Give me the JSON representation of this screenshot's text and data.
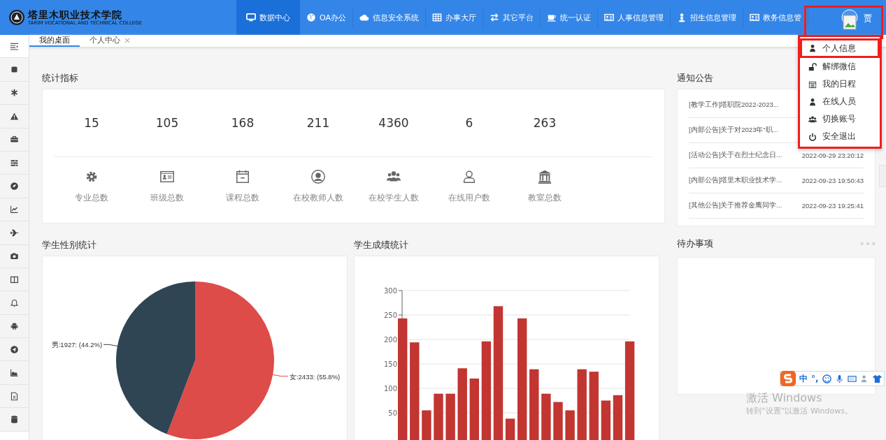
{
  "header": {
    "logo_title": "塔里木职业技术学院",
    "logo_subtitle": "TARIM VOCATIONAL AND TECHNICAL COLLEGE",
    "nav": [
      {
        "label": "数据中心",
        "selected": true
      },
      {
        "label": "OA办公",
        "selected": false
      },
      {
        "label": "信息安全系统",
        "selected": false
      },
      {
        "label": "办事大厅",
        "selected": false
      },
      {
        "label": "其它平台",
        "selected": false
      },
      {
        "label": "统一认证",
        "selected": false
      },
      {
        "label": "人事信息管理",
        "selected": false
      },
      {
        "label": "招生信息管理",
        "selected": false
      },
      {
        "label": "教务信息管",
        "selected": false
      }
    ],
    "user": "贾"
  },
  "tabs": [
    {
      "label": "我的桌面",
      "selected": true,
      "closable": false
    },
    {
      "label": "个人中心",
      "selected": false,
      "closable": true
    }
  ],
  "stats": {
    "title": "统计指标",
    "items": [
      {
        "value": "15",
        "label": "专业总数"
      },
      {
        "value": "105",
        "label": "班级总数"
      },
      {
        "value": "168",
        "label": "课程总数"
      },
      {
        "value": "211",
        "label": "在校教师人数"
      },
      {
        "value": "4360",
        "label": "在校学生人数"
      },
      {
        "value": "6",
        "label": "在线用户数"
      },
      {
        "value": "263",
        "label": "教室总数"
      }
    ]
  },
  "gender_chart": {
    "title": "学生性别统计",
    "chart_data": {
      "type": "pie",
      "categories": [
        "女",
        "男"
      ],
      "values": [
        2433,
        1927
      ],
      "colors": [
        "#dd4c48",
        "#2f4554"
      ],
      "value_labels": [
        ":2433: (55.8%)",
        ":1927: (44.2%)"
      ]
    }
  },
  "score_chart": {
    "title": "学生成绩统计",
    "chart_data": {
      "type": "bar",
      "ylim": [
        0,
        300
      ],
      "yticks": [
        50,
        100,
        150,
        200,
        250,
        300
      ],
      "grid": true,
      "series": [
        {
          "color": "#c23531",
          "values": [
            243,
            194,
            55,
            89,
            89,
            141,
            120,
            196,
            268,
            38,
            243,
            139,
            89,
            72,
            55,
            139,
            134,
            75,
            86,
            196
          ]
        }
      ]
    }
  },
  "notices": {
    "title": "通知公告",
    "items": [
      {
        "title": "[教学工作]塔职院2022-2023..."
      },
      {
        "title": "[内部公告]关于对2023年“职..."
      },
      {
        "title": "[活动公告]关于在烈士纪念日...",
        "time": "2022-09-29 23:20:12"
      },
      {
        "title": "[内部公告]塔里木职业技术学...",
        "time": "2022-09-23 19:50:43"
      },
      {
        "title": "[其他公告]关于推荐金鹰同学...",
        "time": "2022-09-23 19:25:41"
      }
    ]
  },
  "todo": {
    "title": "待办事项"
  },
  "user_menu": {
    "items": [
      {
        "label": "个人信息",
        "selected": true
      },
      {
        "label": "解绑微信",
        "selected": false
      },
      {
        "label": "我的日程",
        "selected": false
      },
      {
        "label": "在线人员",
        "selected": false
      },
      {
        "label": "切换账号",
        "selected": false
      },
      {
        "label": "安全退出",
        "selected": false
      }
    ]
  },
  "ime_bar": {
    "lang": "中",
    "punct": "°,"
  },
  "os_notice": {
    "title": "激活 Windows",
    "text": "转到“设置”以激活 Windows。"
  }
}
